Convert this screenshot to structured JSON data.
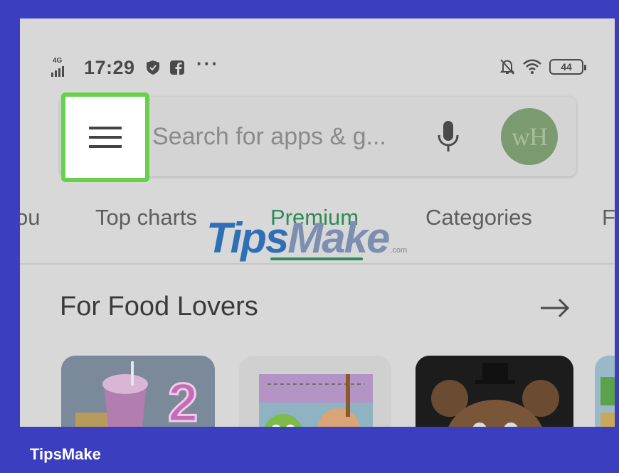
{
  "status_bar": {
    "network_label": "4G",
    "time": "17:29",
    "more_indicator": "···",
    "battery_level": "44",
    "icons": [
      "signal-icon",
      "shield-icon",
      "facebook-icon",
      "bell-off-icon",
      "wifi-icon",
      "battery-icon"
    ]
  },
  "search": {
    "menu_icon": "hamburger-menu-icon",
    "placeholder": "Search for apps & g...",
    "mic_icon": "microphone-icon",
    "avatar_initials": "wH"
  },
  "tabs": [
    {
      "label": "ou",
      "active": false
    },
    {
      "label": "Top charts",
      "active": false
    },
    {
      "label": "Premium",
      "active": true
    },
    {
      "label": "Categories",
      "active": false
    },
    {
      "label": "F",
      "active": false
    }
  ],
  "section": {
    "title": "For Food Lovers",
    "arrow_icon": "arrow-right-icon"
  },
  "watermark": {
    "part1": "Tips",
    "part2": "Make",
    "suffix": ".com"
  },
  "footer": {
    "brand": "TipsMake"
  },
  "colors": {
    "frame": "#3b3fbf",
    "highlight": "#66d24a",
    "active_tab": "#2d8a5a",
    "avatar": "#7c9a6f",
    "screen_dimmed": "#d8d8d8"
  }
}
